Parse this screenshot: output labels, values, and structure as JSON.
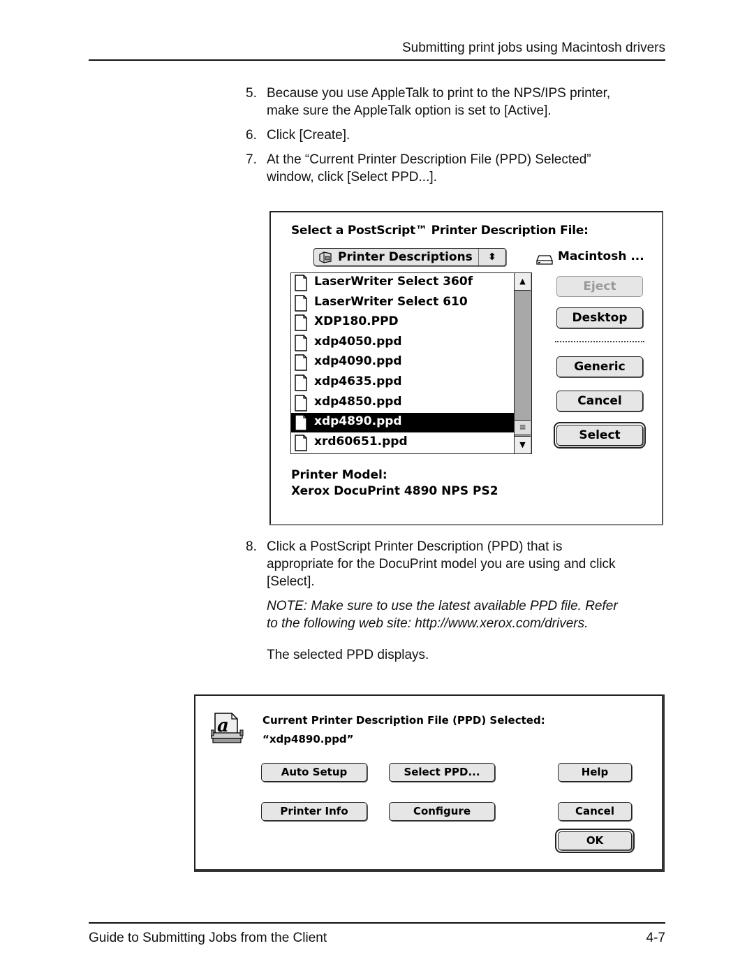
{
  "header": {
    "running_title": "Submitting print jobs using Macintosh drivers"
  },
  "steps": [
    {
      "number": "5.",
      "lines": [
        "Because you use AppleTalk to print to the NPS/IPS printer,",
        "make sure the AppleTalk option is set to [Active]."
      ]
    },
    {
      "number": "6.",
      "lines": [
        "Click [Create]."
      ]
    },
    {
      "number": "7.",
      "lines": [
        "At the “Current Printer Description File (PPD) Selected”",
        "window, click [Select PPD...]."
      ]
    },
    {
      "number": "8.",
      "lines": [
        "Click a PostScript Printer Description (PPD) that is",
        "appropriate for the DocuPrint model you are using and click",
        "[Select]."
      ]
    }
  ],
  "note": {
    "lines": [
      "NOTE:  Make sure to use the latest available PPD file. Refer",
      "to the following web site: http://www.xerox.com/drivers."
    ]
  },
  "result_text": "The selected PPD displays.",
  "select_dialog": {
    "title": "Select a PostScript™ Printer Description File:",
    "folder_popup": {
      "label": "Printer Descriptions",
      "icon": "folder-icon",
      "arrows": "⬍"
    },
    "volume": {
      "icon": "hard-disk-icon",
      "label": "Macintosh ..."
    },
    "files": [
      {
        "name": "LaserWriter Select 360f",
        "selected": false
      },
      {
        "name": "LaserWriter Select 610",
        "selected": false
      },
      {
        "name": "XDP180.PPD",
        "selected": false
      },
      {
        "name": "xdp4050.ppd",
        "selected": false
      },
      {
        "name": "xdp4090.ppd",
        "selected": false
      },
      {
        "name": "xdp4635.ppd",
        "selected": false
      },
      {
        "name": "xdp4850.ppd",
        "selected": false
      },
      {
        "name": "xdp4890.ppd",
        "selected": true
      },
      {
        "name": "xrd60651.ppd",
        "selected": false
      }
    ],
    "scroll": {
      "up": "▲",
      "down": "▼",
      "thumb": "≡"
    },
    "buttons": {
      "eject": "Eject",
      "desktop": "Desktop",
      "generic": "Generic",
      "cancel": "Cancel",
      "select": "Select"
    },
    "printer_model_label": "Printer Model:",
    "printer_model_value": "Xerox DocuPrint 4890 NPS PS2"
  },
  "current_ppd_dialog": {
    "icon": "laserwriter-printer-icon",
    "title": "Current Printer Description File (PPD) Selected:",
    "file": "“xdp4890.ppd”",
    "buttons": {
      "auto_setup": "Auto Setup",
      "select_ppd": "Select PPD...",
      "help": "Help",
      "printer_info": "Printer Info",
      "configure": "Configure",
      "cancel": "Cancel",
      "ok": "OK"
    }
  },
  "footer": {
    "title": "Guide to Submitting Jobs from the Client",
    "page": "4-7"
  }
}
